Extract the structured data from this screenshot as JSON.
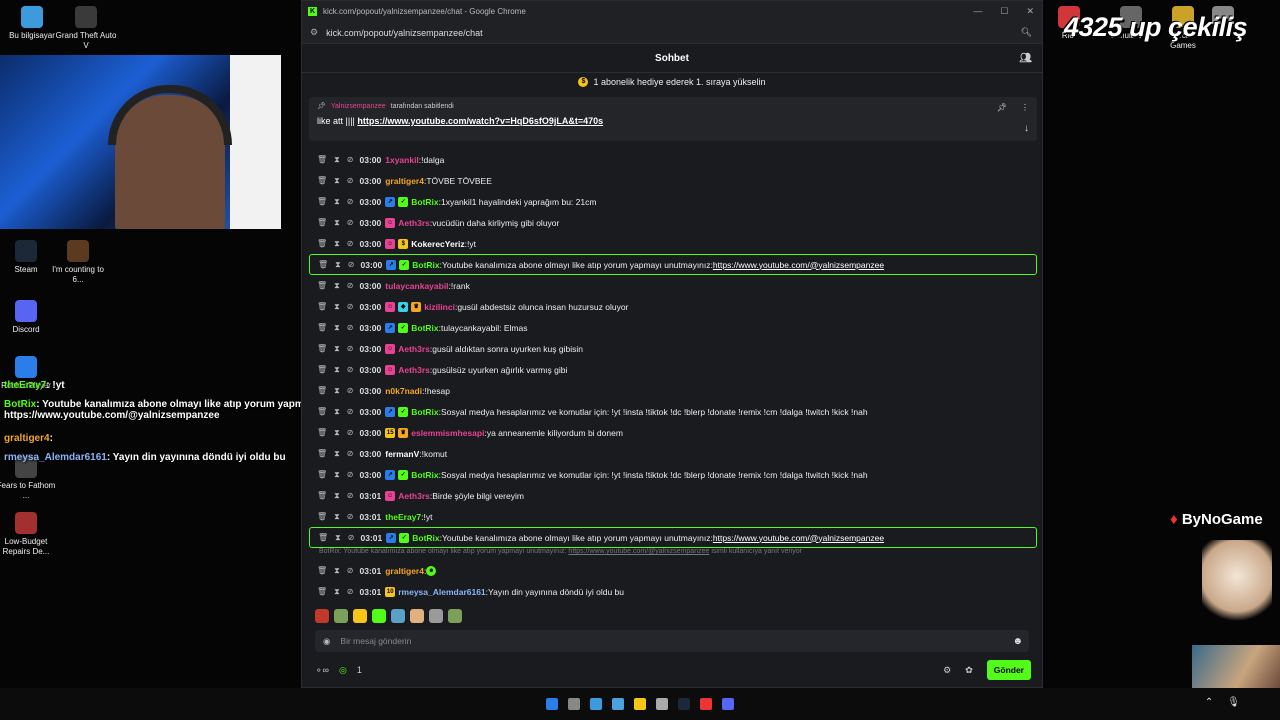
{
  "desktop": {
    "icons": [
      {
        "label": "Bu bilgisayar",
        "color": "#3b9bdc"
      },
      {
        "label": "Grand Theft Auto V",
        "color": "#3a3a3a"
      },
      {
        "label": "Steam",
        "color": "#1b2838"
      },
      {
        "label": "I'm counting to 6...",
        "color": "#5b3a20"
      },
      {
        "label": "Discord",
        "color": "#5865f2"
      },
      {
        "label": "Roblox Player",
        "color": "#2b7de9"
      },
      {
        "label": "Fears to Fathom ...",
        "color": "#444"
      },
      {
        "label": "Low-Budget Repairs De...",
        "color": "#a23030"
      }
    ],
    "right_icons": [
      {
        "label": "Riot",
        "color": "#d13639"
      },
      {
        "label": "Simulator 2",
        "color": "#666"
      },
      {
        "label": "Social Games",
        "color": "#c9a227"
      },
      {
        "label": "2",
        "color": "#888"
      }
    ],
    "giveaway_text": "4325 up çekiliş",
    "brand_text": "ByNoGame",
    "overlay_chat": [
      {
        "user": "theEray7",
        "text": "!yt",
        "color": "#53fc18"
      },
      {
        "user": "BotRix",
        "text": "Youtube kanalımıza abone olmayı like atıp yorum yapmayı unutmayınız: https://www.youtube.com/@yalnizsempanzee",
        "color": "#53fc18"
      },
      {
        "user": "graltiger4",
        "text": "",
        "color": "#f5a623"
      },
      {
        "user": "rmeysa_Alemdar6161",
        "text": "Yayın din yayınına döndü iyi oldu bu",
        "color": "#8ab4f8"
      }
    ]
  },
  "browser": {
    "title": "kick.com/popout/yalnizsempanzee/chat - Google Chrome",
    "url": "kick.com/popout/yalnizsempanzee/chat"
  },
  "chat": {
    "header": "Sohbet",
    "sub_banner": "1 abonelik hediye ederek 1. sıraya yükselin",
    "pinned": {
      "by_user": "Yalnizsempanzee",
      "by_suffix": "tarafından sabitlendi",
      "prefix": "like att ||||",
      "link": "https://www.youtube.com/watch?v=HqD6sfO9jLA&t=470s"
    },
    "messages": [
      {
        "time": "03:00",
        "user": "1xyankil",
        "text": "!dalga",
        "color": "#e84393",
        "badges": []
      },
      {
        "time": "03:00",
        "user": "graltiger4",
        "text": "TÖVBE TÖVBEE",
        "color": "#f5a623",
        "badges": []
      },
      {
        "time": "03:00",
        "user": "BotRix",
        "text": "1xyankil1 hayalindeki yaprağım bu: 21cm",
        "color": "#53fc18",
        "badges": [
          "bot",
          "verified"
        ]
      },
      {
        "time": "03:00",
        "user": "Aeth3rs",
        "text": "vucüdün daha kirliymiş gibi oluyor",
        "color": "#e84393",
        "badges": [
          "sub"
        ]
      },
      {
        "time": "03:00",
        "user": "KokerecYeriz",
        "text": "!yt",
        "color": "#ffffff",
        "badges": [
          "sub",
          "gift"
        ]
      },
      {
        "time": "03:00",
        "user": "BotRix",
        "text": "Youtube kanalımıza abone olmayı like atıp yorum yapmayı unutmayınız:",
        "link": "https://www.youtube.com/@yalnizsempanzee",
        "color": "#53fc18",
        "badges": [
          "bot",
          "verified"
        ],
        "highlight": true
      },
      {
        "time": "03:00",
        "user": "tulaycankayabil",
        "text": "!rank",
        "color": "#e84393",
        "badges": []
      },
      {
        "time": "03:00",
        "user": "kizilinci",
        "text": "gusül abdestsiz olunca insan huzursuz oluyor",
        "color": "#e84393",
        "badges": [
          "sub",
          "og",
          "crown"
        ]
      },
      {
        "time": "03:00",
        "user": "BotRix",
        "text": "tulaycankayabil: Elmas",
        "color": "#53fc18",
        "badges": [
          "bot",
          "verified"
        ]
      },
      {
        "time": "03:00",
        "user": "Aeth3rs",
        "text": "gusül aldıktan sonra uyurken kuş gibisin",
        "color": "#e84393",
        "badges": [
          "sub"
        ]
      },
      {
        "time": "03:00",
        "user": "Aeth3rs",
        "text": "gusülsüz uyurken ağırlık varmış gibi",
        "color": "#e84393",
        "badges": [
          "sub"
        ]
      },
      {
        "time": "03:00",
        "user": "n0k7nadi",
        "text": "!hesap",
        "color": "#f5a623",
        "badges": []
      },
      {
        "time": "03:00",
        "user": "BotRix",
        "text": "Sosyal medya hesaplarımız ve komutlar için: !yt !insta !tiktok !dc !blerp !donate !remix !cm !dalga !twitch !kick !nah",
        "color": "#53fc18",
        "badges": [
          "bot",
          "verified"
        ]
      },
      {
        "time": "03:00",
        "user": "eslemmismhesapi",
        "text": "ya anneanemle kiliyordum bi donem",
        "color": "#e84393",
        "badges": [
          "sub15",
          "crown"
        ]
      },
      {
        "time": "03:00",
        "user": "fermanV",
        "text": "!komut",
        "color": "#ffffff",
        "badges": []
      },
      {
        "time": "03:00",
        "user": "BotRix",
        "text": "Sosyal medya hesaplarımız ve komutlar için: !yt !insta !tiktok !dc !blerp !donate !remix !cm !dalga !twitch !kick !nah",
        "color": "#53fc18",
        "badges": [
          "bot",
          "verified"
        ]
      },
      {
        "time": "03:01",
        "user": "Aeth3rs",
        "text": "Birde şöyle bilgi vereyim",
        "color": "#e84393",
        "badges": [
          "sub"
        ]
      },
      {
        "time": "03:01",
        "user": "theEray7",
        "text": "!yt",
        "color": "#53fc18",
        "badges": []
      },
      {
        "time": "03:01",
        "user": "BotRix",
        "text": "Youtube kanalımıza abone olmayı like atıp yorum yapmayı unutmayınız:",
        "link": "https://www.youtube.com/@yalnizsempanzee",
        "color": "#53fc18",
        "badges": [
          "bot",
          "verified"
        ],
        "highlight": true
      }
    ],
    "reply_note": {
      "text": "BotRix: Youtube kanalımıza abone olmayı like atıp yorum yapmayı unutmayınız:",
      "link": "https://www.youtube.com/@yalnizsempanzee",
      "suffix": "isimli kullanıcıya yanıt veriyor"
    },
    "messages_after": [
      {
        "time": "03:01",
        "user": "graltiger4",
        "text": "",
        "color": "#f5a623",
        "badges": []
      },
      {
        "time": "03:01",
        "user": "rmeysa_Alemdar6161",
        "text": "Yayın din yayınına döndü iyi oldu bu",
        "color": "#8ab4f8",
        "badges": [
          "sub10"
        ]
      }
    ],
    "input_placeholder": "Bir mesaj gönderin",
    "viewer_count": "1",
    "send_label": "Gönder"
  },
  "colors": {
    "accent": "#53fc18",
    "bg": "#191b1f"
  }
}
